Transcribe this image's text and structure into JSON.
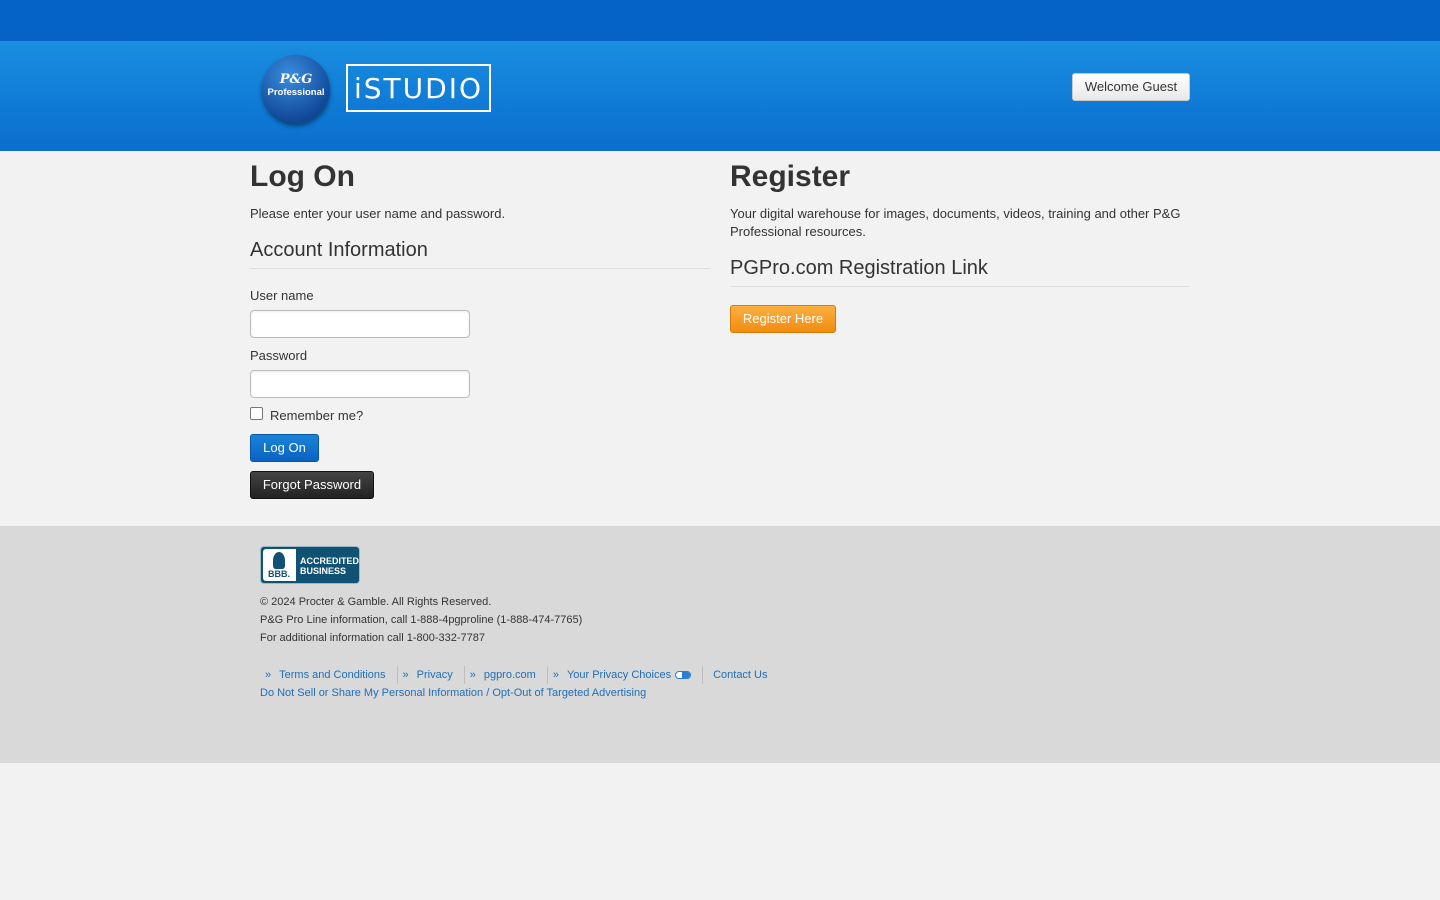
{
  "header": {
    "logo_pg": "P&G",
    "logo_professional": "Professional",
    "brand": "iSTUDIO",
    "welcome_label": "Welcome Guest"
  },
  "logon": {
    "title": "Log On",
    "intro": "Please enter your user name and password.",
    "section_title": "Account Information",
    "username_label": "User name",
    "username_value": "",
    "password_label": "Password",
    "password_value": "",
    "remember_label": "Remember me?",
    "remember_checked": false,
    "logon_button": "Log On",
    "forgot_button": "Forgot Password"
  },
  "register": {
    "title": "Register",
    "description": "Your digital warehouse for images, documents, videos, training and other P&G Professional resources.",
    "section_title": "PGPro.com Registration Link",
    "register_button": "Register Here"
  },
  "footer": {
    "bbb_logo_text": "BBB.",
    "bbb_badge_line1": "ACCREDITED",
    "bbb_badge_line2": "BUSINESS",
    "copyright": "© 2024 Procter & Gamble. All Rights Reserved.",
    "pro_line": "P&G Pro Line information, call 1-888-4pgproline (1-888-474-7765)",
    "additional": "For additional information call 1-800-332-7787",
    "links": [
      {
        "label": "Terms and Conditions",
        "prefix": "»"
      },
      {
        "label": "Privacy",
        "prefix": "»"
      },
      {
        "label": "pgpro.com",
        "prefix": "»"
      },
      {
        "label": "Your Privacy Choices",
        "prefix": "»",
        "icon": "privacy-choices-icon"
      },
      {
        "label": "Contact Us",
        "prefix": ""
      }
    ],
    "do_not_sell": "Do Not Sell or Share My Personal Information / Opt-Out of Targeted Advertising"
  }
}
